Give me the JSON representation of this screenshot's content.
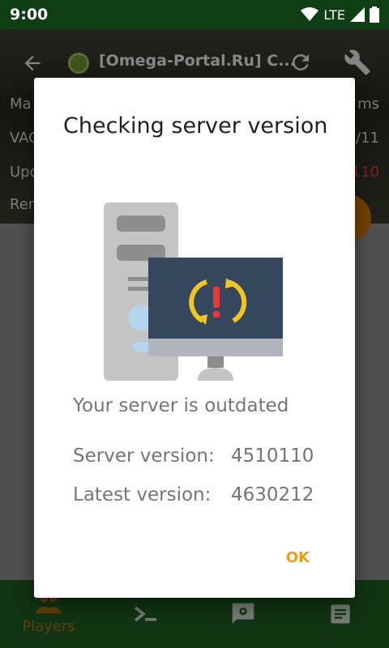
{
  "status_bar": {
    "time": "9:00",
    "network": "LTE"
  },
  "header": {
    "title": "[Omega-Portal.Ru] C..."
  },
  "background_rows": [
    {
      "label": "Ma",
      "value": "ms"
    },
    {
      "label": "VAC",
      "value": "/11"
    },
    {
      "label": "Upd",
      "value": "110"
    },
    {
      "label": "Rem",
      "value": ""
    }
  ],
  "dialog": {
    "title": "Checking server version",
    "message": "Your server is outdated",
    "server_version_label": "Server version:",
    "server_version_value": "4510110",
    "latest_version_label": "Latest version:",
    "latest_version_value": "4630212",
    "ok_label": "OK"
  },
  "bottom_nav": {
    "players_label": "Players"
  },
  "colors": {
    "accent": "#ef9a16",
    "primary_dark": "#0f3d14",
    "nav_bg": "#1e5a22",
    "outdated_red": "#e53935"
  }
}
